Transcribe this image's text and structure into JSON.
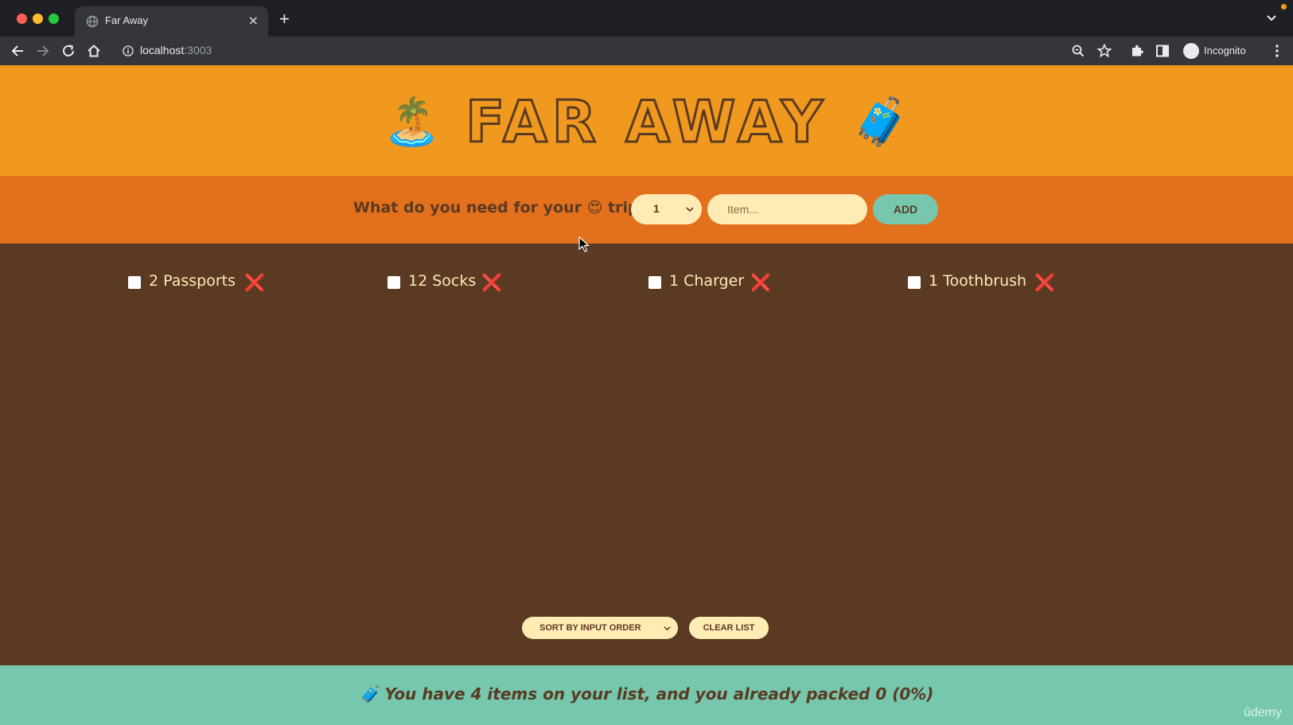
{
  "browser": {
    "tab_title": "Far Away",
    "tab_close": "×",
    "new_tab": "+",
    "url_host": "localhost",
    "url_port": ":3003",
    "profile_label": "Incognito"
  },
  "header": {
    "emoji_left": "🏝️",
    "title": "FAR AWAY",
    "emoji_right": "🧳"
  },
  "form": {
    "prompt": "What do you need for your 😍 trip?",
    "quantity_value": "1",
    "item_placeholder": "Item...",
    "add_label": "ADD"
  },
  "items": [
    {
      "label": "2 Passports",
      "packed": false,
      "delete": "❌"
    },
    {
      "label": "12 Socks",
      "packed": false,
      "delete": "❌"
    },
    {
      "label": "1 Charger",
      "packed": false,
      "delete": "❌"
    },
    {
      "label": "1 Toothbrush",
      "packed": false,
      "delete": "❌"
    }
  ],
  "actions": {
    "sort_label": "SORT BY INPUT ORDER",
    "clear_label": "CLEAR LIST"
  },
  "footer": {
    "stats": "🧳 You have 4 items on your list, and you already packed 0 (0%)"
  },
  "watermark": "ûdemy",
  "colors": {
    "header": "#f0991e",
    "form": "#e2701c",
    "list": "#5a3a22",
    "footer": "#76c7ad",
    "cream": "#ffebb3",
    "delete": "#e5101e"
  }
}
